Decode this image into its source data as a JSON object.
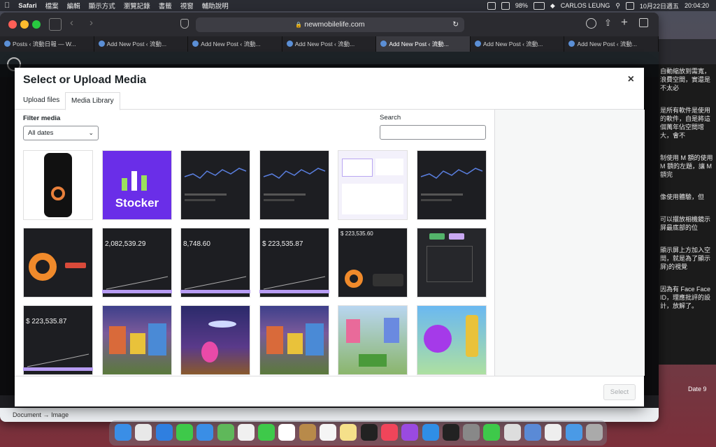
{
  "menubar": {
    "apple": "",
    "items": [
      "Safari",
      "檔案",
      "編輯",
      "顯示方式",
      "瀏覽記錄",
      "書籤",
      "視窗",
      "輔助說明"
    ],
    "battery": "98%",
    "user": "CARLOS LEUNG",
    "date": "10月22日週五",
    "time": "20:04:20"
  },
  "browser": {
    "address": "newmobilelife.com",
    "tabs": [
      {
        "label": "Posts ‹ 流動日報 — W..."
      },
      {
        "label": "Add New Post ‹ 流動..."
      },
      {
        "label": "Add New Post ‹ 流動..."
      },
      {
        "label": "Add New Post ‹ 流動..."
      },
      {
        "label": "Add New Post ‹ 流動..."
      },
      {
        "label": "Add New Post ‹ 流動..."
      },
      {
        "label": "Add New Post ‹ 流動..."
      }
    ],
    "active_tab": 4
  },
  "editor": {
    "breadcrumb": [
      "Document",
      "Image"
    ]
  },
  "modal": {
    "title": "Select or Upload Media",
    "close": "×",
    "tabs": [
      "Upload files",
      "Media Library"
    ],
    "filter_label": "Filter media",
    "filter_value": "All dates",
    "search_label": "Search",
    "search_placeholder": "",
    "select_button": "Select"
  },
  "thumbs": [
    {
      "kind": "phone",
      "text": ""
    },
    {
      "kind": "stocker",
      "text": "Stocker"
    },
    {
      "kind": "darkchart",
      "text": ""
    },
    {
      "kind": "darkchart",
      "text": ""
    },
    {
      "kind": "light",
      "text": ""
    },
    {
      "kind": "darkchart",
      "text": ""
    },
    {
      "kind": "donut",
      "text": ""
    },
    {
      "kind": "value",
      "text": "2,082,539.29"
    },
    {
      "kind": "value",
      "text": "8,748.60"
    },
    {
      "kind": "value",
      "text": "$ 223,535.87"
    },
    {
      "kind": "donut2",
      "text": "$ 223,535.60"
    },
    {
      "kind": "form",
      "text": ""
    },
    {
      "kind": "value",
      "text": "$ 223,535.87"
    },
    {
      "kind": "city",
      "text": ""
    },
    {
      "kind": "night",
      "text": ""
    },
    {
      "kind": "city",
      "text": ""
    },
    {
      "kind": "city2",
      "text": ""
    },
    {
      "kind": "racer",
      "text": ""
    }
  ],
  "article": {
    "paragraphs": [
      "自動縮放到需寬，浪費空間，實還是不太必",
      "是所有軟件是使用的軟件，自是將這個萬年佔空間增大，會不",
      "制使用 M 額的使用 M 額的左題，讓 M 額完",
      "像使用體驗，但",
      "可以擺放相機鏡示屏最底部的位",
      "顯示屏上方加入空間，就是為了顯示屏)的視覺",
      "因為有 Face Face ID，理應批評的設計，放解了。"
    ],
    "date_label": "Date 9"
  },
  "colors": {
    "wp_admin": "#1d2327",
    "stocker_purple": "#6a2ee8",
    "accent_blue": "#2271b1"
  }
}
